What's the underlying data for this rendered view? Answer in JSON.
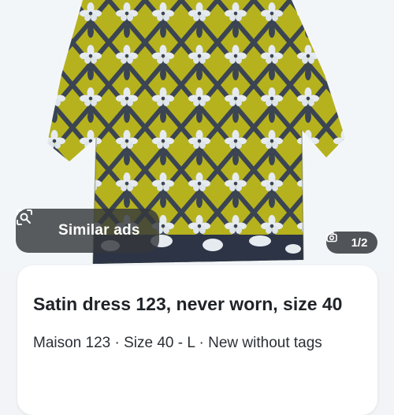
{
  "image": {
    "alt": "Satin dress photo",
    "pattern_colors": {
      "fabric": "#b5b21e",
      "lattice": "#3b4452",
      "flower": "#e6ebf0",
      "hem": "#2c3446",
      "background": "#f3f6f9"
    }
  },
  "similar_ads": {
    "label": "Similar ads",
    "icon": "visual-search-icon"
  },
  "photo_counter": {
    "text": "1/2",
    "icon": "camera-icon"
  },
  "listing": {
    "title": "Satin dress 123, never worn, size 40",
    "meta": "Maison 123 · Size 40 - L · New without tags"
  }
}
